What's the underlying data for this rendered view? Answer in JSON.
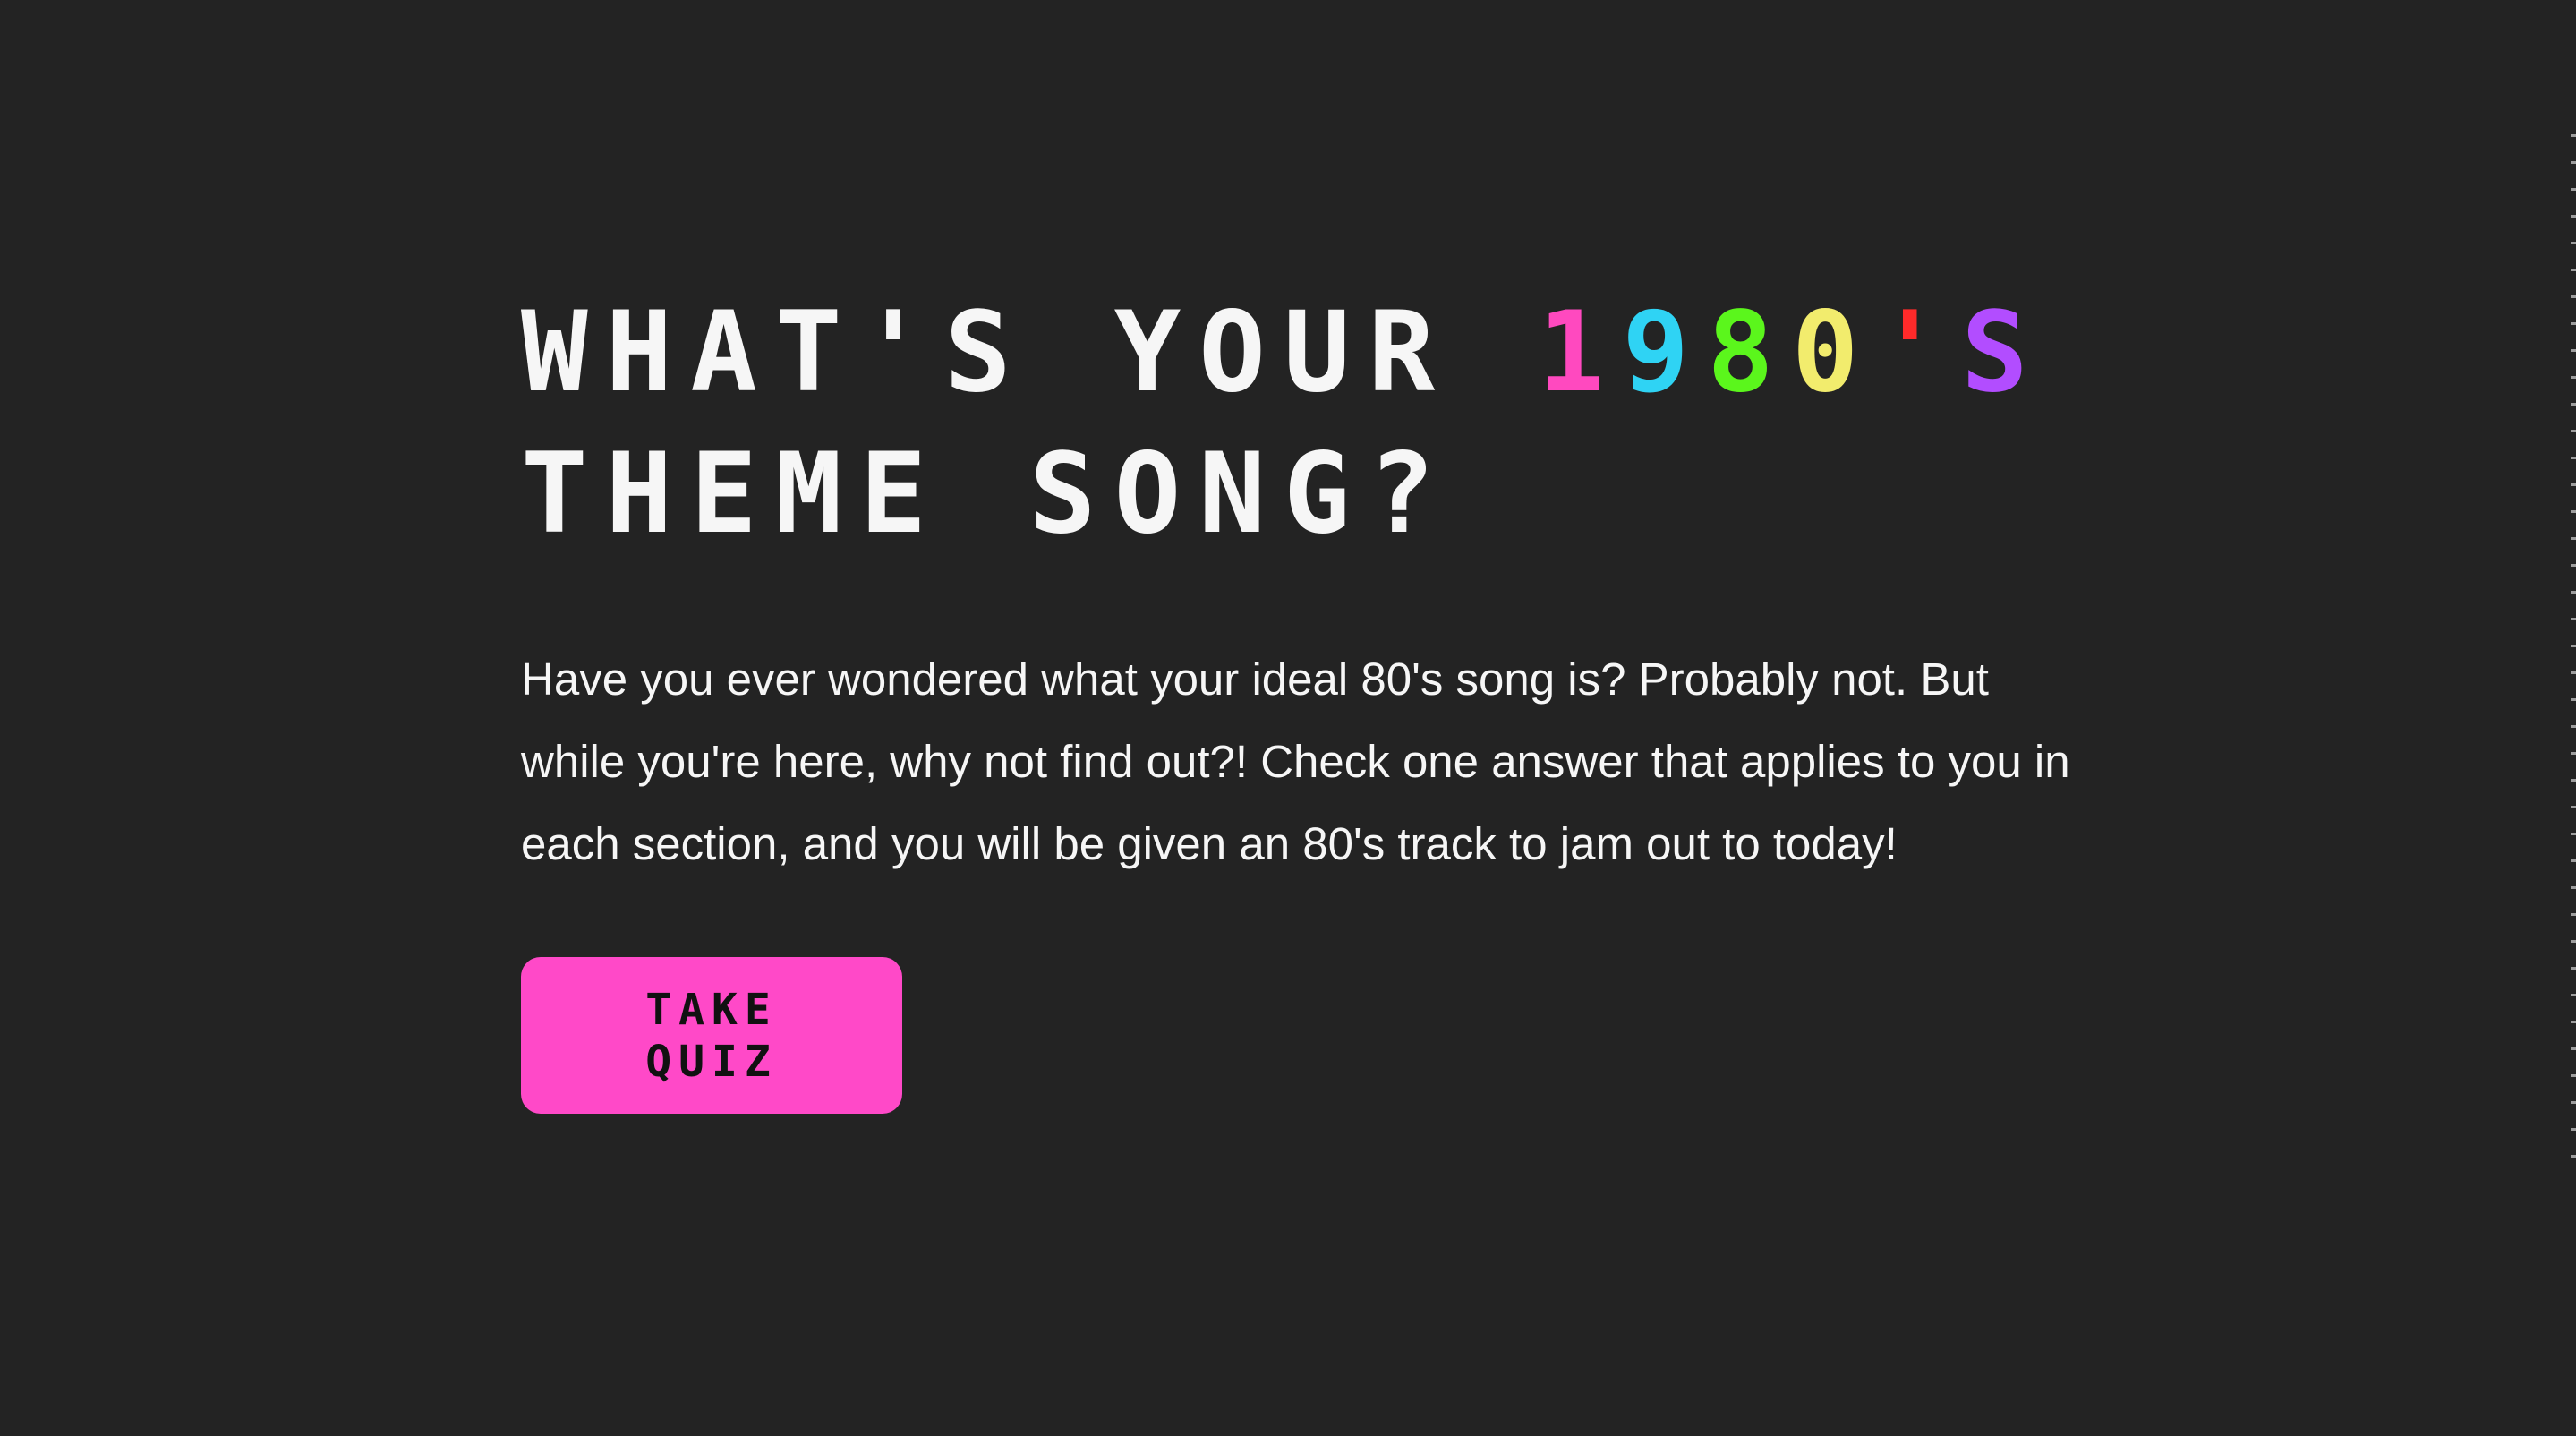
{
  "hero": {
    "title_line1_prefix": "WHAT'S YOUR ",
    "title_year": {
      "digit1": "1",
      "digit2": "9",
      "digit3": "8",
      "digit4": "0",
      "apostrophe": "'",
      "suffix": "S"
    },
    "title_line2": "THEME SONG?",
    "intro": "Have you ever wondered what your ideal 80's song is? Probably not. But while you're here, why not find out?! Check one answer that applies to you in each section, and you will be given an 80's track to jam out to today!",
    "button_label": "TAKE QUIZ"
  },
  "colors": {
    "background": "#232323",
    "text": "#f6f6f6",
    "digit_1": "#ff49bf",
    "digit_9": "#2fd3f4",
    "digit_8": "#5bf61c",
    "digit_0": "#f2ec6d",
    "apostrophe": "#ff2a2a",
    "letter_s": "#b24dff",
    "button": "#ff49c8",
    "button_text": "#111111"
  }
}
